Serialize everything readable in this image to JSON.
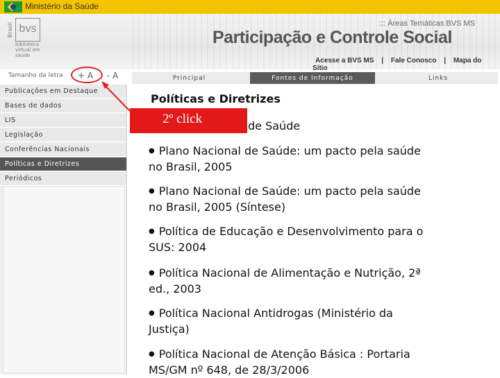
{
  "gov_bar": {
    "title": "Ministério da Saúde"
  },
  "banner": {
    "logo_text": "bvs",
    "logo_country": "Brasil",
    "logo_library_line1": "biblioteca",
    "logo_library_line2": "virtual em saúde",
    "areas": "::: Áreas Temáticas BVS MS",
    "title": "Participação e Controle Social",
    "links": [
      "Acesse a BVS MS",
      "Fale Conosco",
      "Mapa do Sítio"
    ],
    "link_separator": "|"
  },
  "font_size": {
    "label": "Tamanho da letra",
    "increase": "+ A",
    "decrease": "- A"
  },
  "tabs": [
    {
      "label": "Principal",
      "active": false
    },
    {
      "label": "Fontes de Informação",
      "active": true
    },
    {
      "label": "Links",
      "active": false
    }
  ],
  "sidebar": {
    "items": [
      {
        "label": "Publicações em Destaque",
        "active": false
      },
      {
        "label": "Bases de dados",
        "active": false
      },
      {
        "label": "LIS",
        "active": false
      },
      {
        "label": "Legislação",
        "active": false
      },
      {
        "label": "Conferências Nacionais",
        "active": false
      },
      {
        "label": "Políticas e Diretrizes",
        "active": true
      },
      {
        "label": "Periódicos",
        "active": false
      }
    ]
  },
  "content": {
    "title": "Políticas e Diretrizes",
    "subtitle_visible": "de Saúde",
    "documents": [
      {
        "line1": "Plano Nacional de Saúde: um pacto pela saúde",
        "line2": "no Brasil, 2005"
      },
      {
        "line1": "Plano Nacional de Saúde: um pacto pela saúde",
        "line2": "no Brasil, 2005 (Síntese)"
      },
      {
        "line1": "Política de Educação e Desenvolvimento para o",
        "line2": "SUS: 2004"
      },
      {
        "line1": "Política Nacional de Alimentação e Nutrição, 2ª",
        "line2": "ed., 2003"
      },
      {
        "line1": "Política Nacional Antidrogas (Ministério da",
        "line2": "Justiça)"
      },
      {
        "line1": "Política Nacional de Atenção Básica : Portaria",
        "line2": "MS/GM nº 648, de 28/3/2006"
      }
    ]
  },
  "annotation": {
    "text": "2º click",
    "color": "#e31818"
  },
  "colors": {
    "gov_bar": "#f4c400",
    "active_tab": "#5a5a5a",
    "active_sidebar": "#555555"
  }
}
